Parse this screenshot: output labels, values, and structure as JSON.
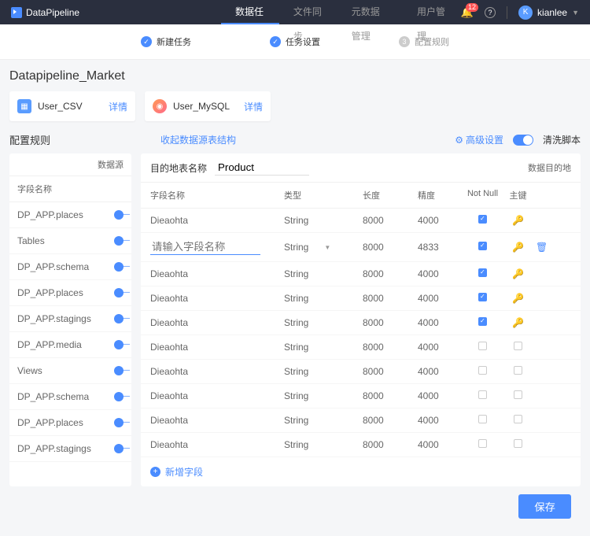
{
  "header": {
    "brand": "DataPipeline",
    "nav": [
      "数据任务",
      "文件同步",
      "元数据管理",
      "用户管理"
    ],
    "badge": "12",
    "user": "kianlee",
    "avatar": "K"
  },
  "steps": [
    {
      "label": "新建任务"
    },
    {
      "label": "任务设置"
    },
    {
      "label": "配置规则",
      "num": "3"
    }
  ],
  "title": "Datapipeline_Market",
  "cards": [
    {
      "name": "User_CSV",
      "link": "详情"
    },
    {
      "name": "User_MySQL",
      "link": "详情"
    }
  ],
  "sec": {
    "title": "配置规则",
    "collapse": "收起数据源表结构",
    "adv": "高级设置",
    "clean": "清洗脚本"
  },
  "left": {
    "head": "数据源",
    "th": "字段名称",
    "rows": [
      "DP_APP.places",
      "Tables",
      "DP_APP.schema",
      "DP_APP.places",
      "DP_APP.stagings",
      "DP_APP.media",
      "Views",
      "DP_APP.schema",
      "DP_APP.places",
      "DP_APP.stagings"
    ]
  },
  "right": {
    "destLabel": "目的地表名称",
    "destVal": "Product",
    "destR": "数据目的地",
    "cols": [
      "字段名称",
      "类型",
      "长度",
      "精度",
      "Not Null",
      "主键"
    ],
    "placeholder": "请输入字段名称",
    "rows": [
      {
        "n": "Dieaohta",
        "t": "String",
        "l": "8000",
        "p": "4000",
        "nn": true,
        "pk": true
      },
      {
        "n": "",
        "t": "String",
        "sel": true,
        "l": "8000",
        "p": "4833",
        "nn": true,
        "pk": true,
        "del": true
      },
      {
        "n": "Dieaohta",
        "t": "String",
        "l": "8000",
        "p": "4000",
        "nn": true,
        "pk": true
      },
      {
        "n": "Dieaohta",
        "t": "String",
        "l": "8000",
        "p": "4000",
        "nn": true,
        "pk": true
      },
      {
        "n": "Dieaohta",
        "t": "String",
        "l": "8000",
        "p": "4000",
        "nn": true,
        "pk": true
      },
      {
        "n": "Dieaohta",
        "t": "String",
        "l": "8000",
        "p": "4000",
        "nn": false,
        "pk": false
      },
      {
        "n": "Dieaohta",
        "t": "String",
        "l": "8000",
        "p": "4000",
        "nn": false,
        "pk": false
      },
      {
        "n": "Dieaohta",
        "t": "String",
        "l": "8000",
        "p": "4000",
        "nn": false,
        "pk": false
      },
      {
        "n": "Dieaohta",
        "t": "String",
        "l": "8000",
        "p": "4000",
        "nn": false,
        "pk": false
      },
      {
        "n": "Dieaohta",
        "t": "String",
        "l": "8000",
        "p": "4000",
        "nn": false,
        "pk": false
      }
    ],
    "add": "新增字段"
  },
  "save": "保存"
}
